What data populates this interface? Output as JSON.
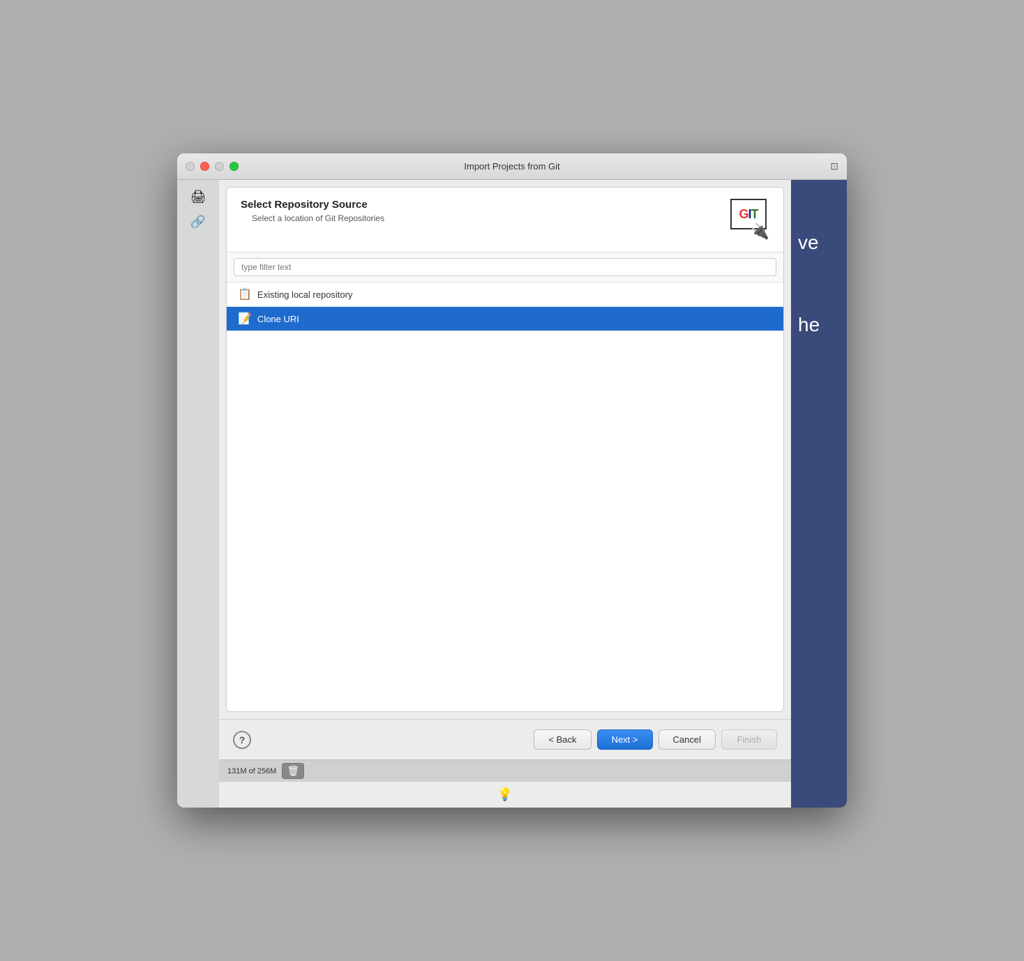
{
  "window": {
    "title": "Import Projects from Git"
  },
  "dialog": {
    "title": "Select Repository Source",
    "subtitle": "Select a location of Git Repositories",
    "filter_placeholder": "type filter text",
    "git_icon_letters": {
      "g": "G",
      "i": "I",
      "t": "T"
    }
  },
  "list_items": [
    {
      "id": "existing-local",
      "label": "Existing local repository",
      "icon": "📋",
      "selected": false
    },
    {
      "id": "clone-uri",
      "label": "Clone URI",
      "icon": "📝",
      "selected": true
    }
  ],
  "footer": {
    "help_label": "?",
    "back_label": "< Back",
    "next_label": "Next >",
    "cancel_label": "Cancel",
    "finish_label": "Finish"
  },
  "status_bar": {
    "memory": "131M of 256M"
  },
  "right_panel": {
    "text_visible": "ve\n\nhe"
  }
}
